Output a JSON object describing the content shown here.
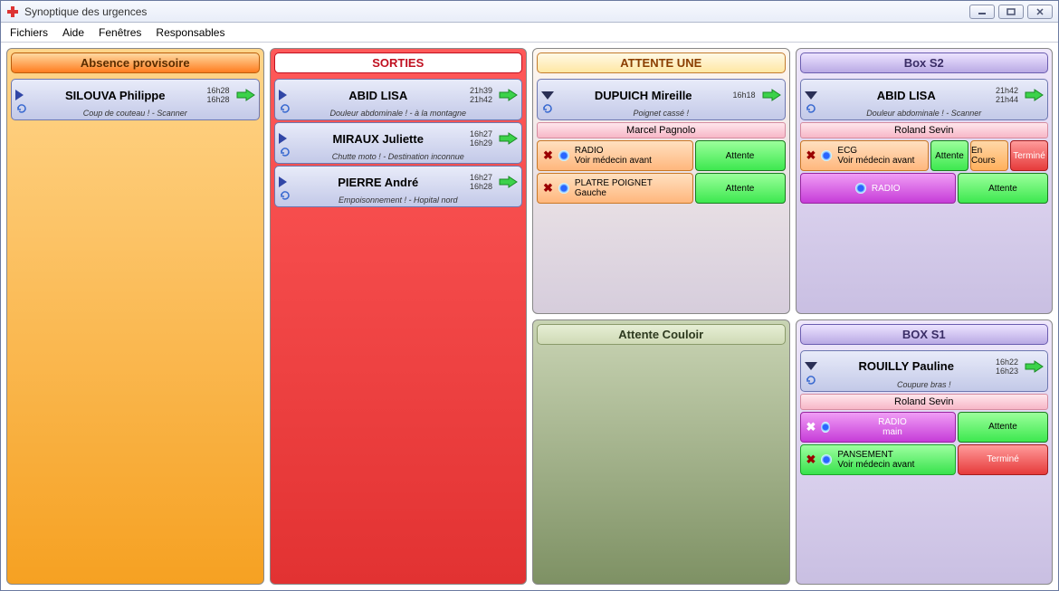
{
  "window": {
    "title": "Synoptique des urgences"
  },
  "menu": {
    "fichiers": "Fichiers",
    "aide": "Aide",
    "fenetres": "Fenêtres",
    "responsables": "Responsables"
  },
  "statuses": {
    "attente": "Attente",
    "encours": "En Cours",
    "termine": "Terminé"
  },
  "panels": {
    "attente_une": {
      "title": "ATTENTE UNE",
      "patient": {
        "name": "DUPUICH Mireille",
        "t1": "16h18",
        "t2": "",
        "note": "Poignet cassé !"
      },
      "doctor": "Marcel Pagnolo",
      "tasks": [
        {
          "title": "RADIO",
          "sub": "Voir médecin avant",
          "style": "peach",
          "chips": [
            "attente"
          ]
        },
        {
          "title": "PLATRE POIGNET",
          "sub": "Gauche",
          "style": "peach",
          "chips": [
            "attente"
          ]
        }
      ]
    },
    "box_s2": {
      "title": "Box S2",
      "patient": {
        "name": "ABID LISA",
        "t1": "21h42",
        "t2": "21h44",
        "note": "Douleur abdominale ! - Scanner"
      },
      "doctor": "Roland Sevin",
      "tasks": [
        {
          "title": "ECG",
          "sub": "Voir médecin avant",
          "style": "peach",
          "chips": [
            "attente",
            "encours",
            "termine"
          ]
        },
        {
          "title": "RADIO",
          "sub": "",
          "style": "mag",
          "chips": [
            "attente"
          ]
        }
      ]
    },
    "abs": {
      "title": "Absence provisoire",
      "patient": {
        "name": "SILOUVA Philippe",
        "t1": "16h28",
        "t2": "16h28",
        "note": "Coup de couteau ! - Scanner"
      }
    },
    "sorties": {
      "title": "SORTIES",
      "items": [
        {
          "name": "ABID LISA",
          "t1": "21h39",
          "t2": "21h42",
          "note": "Douleur abdominale ! - à la montagne"
        },
        {
          "name": "MIRAUX Juliette",
          "t1": "16h27",
          "t2": "16h29",
          "note": "Chutte moto ! - Destination inconnue"
        },
        {
          "name": "PIERRE André",
          "t1": "16h27",
          "t2": "16h28",
          "note": "Empoisonnement ! - Hopital nord"
        }
      ]
    },
    "couloir": {
      "title": "Attente Couloir"
    },
    "box_s1": {
      "title": "BOX S1",
      "patient": {
        "name": "ROUILLY Pauline",
        "t1": "16h22",
        "t2": "16h23",
        "note": "Coupure bras !"
      },
      "doctor": "Roland Sevin",
      "tasks": [
        {
          "title": "RADIO",
          "sub": "main",
          "style": "mag",
          "chips": [
            "attente"
          ]
        },
        {
          "title": "PANSEMENT",
          "sub": "Voir médecin avant",
          "style": "green",
          "chips": [
            "termine"
          ]
        }
      ]
    }
  }
}
